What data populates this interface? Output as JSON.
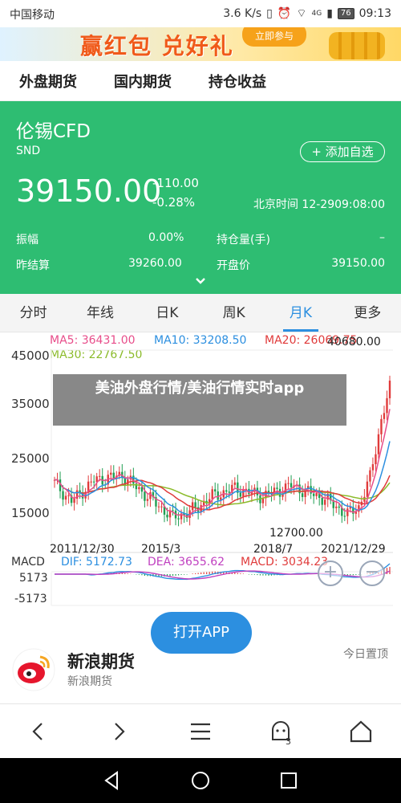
{
  "status_bar": {
    "carrier": "中国移动",
    "speed": "3.6 K/s",
    "network": "4G",
    "battery": "76",
    "time": "09:13"
  },
  "banner": {
    "text": "赢红包 兑好礼",
    "button": "立即参与"
  },
  "top_nav": {
    "items": [
      "外盘期货",
      "国内期货",
      "持仓收益"
    ]
  },
  "quote": {
    "name": "伦锡CFD",
    "code": "SND",
    "add_watch": "+ 添加自选",
    "price": "39150.00",
    "change": "-110.00",
    "change_pct": "-0.28%",
    "time_label": "北京时间 12-2909:08:00",
    "stats": {
      "amplitude_label": "振幅",
      "amplitude": "0.00%",
      "open_interest_label": "持仓量(手)",
      "open_interest": "–",
      "prev_settle_label": "昨结算",
      "prev_settle": "39260.00",
      "open_label": "开盘价",
      "open": "39150.00"
    },
    "colors": {
      "panel": "#2ebd72"
    }
  },
  "period_tabs": {
    "items": [
      "分时",
      "年线",
      "日K",
      "周K",
      "月K",
      "更多"
    ],
    "active": "月K",
    "active_color": "#2c8fe0"
  },
  "chart_labels": {
    "ma5": "MA5: 36431.00",
    "ma10": "MA10: 33208.50",
    "ma20": "MA20: 26069.75",
    "ma30": "MA30: 22767.50",
    "y_ticks": [
      "45000",
      "35000",
      "25000",
      "15000"
    ],
    "high": "40680.00",
    "low": "12700.00",
    "x_ticks": [
      "2011/12/30",
      "2015/3",
      "2018/7",
      "2021/12/29"
    ],
    "macd": "MACD",
    "dif": "DIF: 5172.73",
    "dea": "DEA: 3655.62",
    "macd_val": "MACD: 3034.23",
    "macd_ticks": [
      "5173",
      "-5173"
    ],
    "overlay_title": "美油外盘行情/美油行情实时app",
    "zoom_in": "+",
    "zoom_out": "−",
    "colors": {
      "ma5": "#e84d8a",
      "ma10": "#2c8fe0",
      "ma20": "#e03b3b",
      "ma30": "#8bbb2a",
      "up": "#e03b3b",
      "down": "#1f9e52"
    }
  },
  "promo": {
    "brand": "新浪期货",
    "brand_sub": "新浪期货",
    "open_button": "打开APP",
    "today": "今日置顶"
  },
  "browser_bar": {
    "icons": [
      "back-icon",
      "forward-icon",
      "menu-icon",
      "tabs-icon",
      "home-icon"
    ],
    "tabs_count": "3"
  },
  "system_nav": {
    "icons": [
      "nav-back-icon",
      "nav-home-icon",
      "nav-recent-icon"
    ]
  }
}
